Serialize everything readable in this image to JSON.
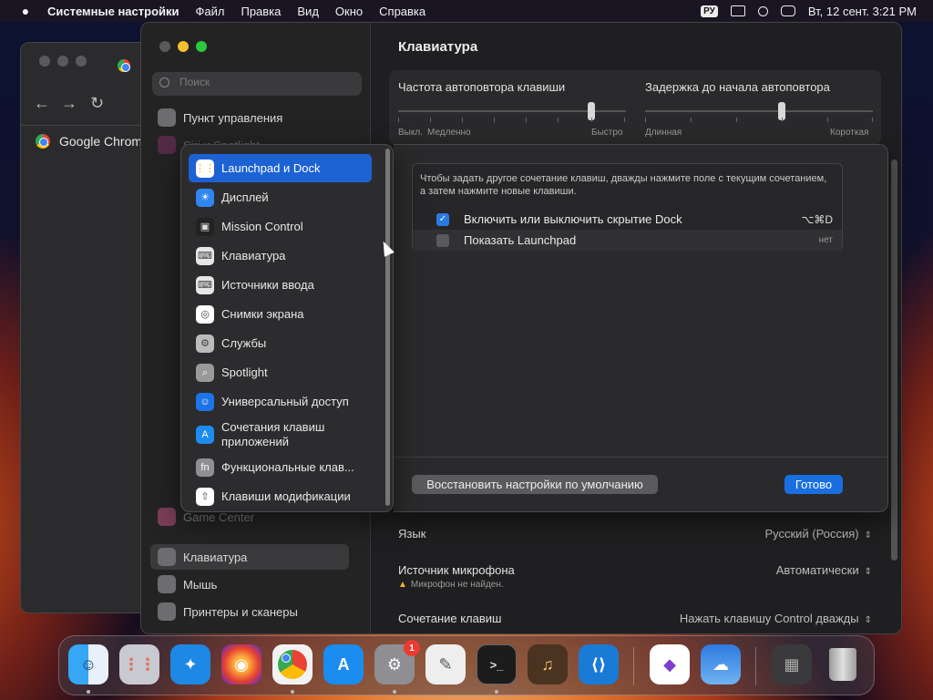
{
  "menubar": {
    "app_name": "Системные настройки",
    "items": [
      "Файл",
      "Правка",
      "Вид",
      "Окно",
      "Справка"
    ],
    "input_language": "РУ",
    "datetime": "Вт, 12 сент.  3:21 PM"
  },
  "chrome_window": {
    "tab_label": "Google Chrome"
  },
  "sidebar": {
    "search_placeholder": "Поиск",
    "items": [
      {
        "label": "Пункт управления",
        "icon": "control-center-icon"
      },
      {
        "label": "Siri и Spotlight",
        "icon": "siri-icon"
      },
      {
        "label": "Game Center",
        "icon": "game-center-icon"
      },
      {
        "label": "Клавиатура",
        "icon": "keyboard-icon"
      },
      {
        "label": "Мышь",
        "icon": "mouse-icon"
      },
      {
        "label": "Принтеры и сканеры",
        "icon": "printer-icon"
      }
    ]
  },
  "main": {
    "title": "Клавиатура",
    "key_repeat": {
      "label": "Частота автоповтора клавиши",
      "min_label": "Выкл.",
      "low_label": "Медленно",
      "max_label": "Быстро"
    },
    "delay_until_repeat": {
      "label": "Задержка до начала автоповтора",
      "min_label": "Длинная",
      "max_label": "Короткая"
    },
    "dictation": {
      "language_label": "Язык",
      "language_value": "Русский (Россия)",
      "mic_label": "Источник микрофона",
      "mic_value": "Автоматически",
      "mic_warning": "Микрофон не найден.",
      "shortcut_label": "Сочетание клавиш",
      "shortcut_value": "Нажать клавишу Control дважды"
    }
  },
  "shortcut_categories": {
    "items": [
      {
        "label": "Launchpad и Dock",
        "icon": "launchpad-icon",
        "glyph": "⋮⋮",
        "selected": true
      },
      {
        "label": "Дисплей",
        "icon": "display-icon",
        "glyph": "☀"
      },
      {
        "label": "Mission Control",
        "icon": "mission-control-icon",
        "glyph": "▣"
      },
      {
        "label": "Клавиатура",
        "icon": "keyboard-icon",
        "glyph": "⌨"
      },
      {
        "label": "Источники ввода",
        "icon": "input-sources-icon",
        "glyph": "⌨"
      },
      {
        "label": "Снимки экрана",
        "icon": "screenshot-icon",
        "glyph": "◎"
      },
      {
        "label": "Службы",
        "icon": "services-icon",
        "glyph": "⚙"
      },
      {
        "label": "Spotlight",
        "icon": "spotlight-icon",
        "glyph": "⌕"
      },
      {
        "label": "Универсальный доступ",
        "icon": "accessibility-icon",
        "glyph": "☺"
      },
      {
        "label": "Сочетания клавиш приложений",
        "icon": "app-shortcuts-icon",
        "glyph": "A"
      },
      {
        "label": "Функциональные клав...",
        "icon": "fn-keys-icon",
        "glyph": "fn"
      },
      {
        "label": "Клавиши модификации",
        "icon": "modifier-keys-icon",
        "glyph": "⇧"
      }
    ]
  },
  "shortcut_panel": {
    "description": "Чтобы задать другое сочетание клавиш, дважды нажмите поле с текущим сочетанием, а затем нажмите новые клавиши.",
    "rows": [
      {
        "label": "Включить или выключить скрытие Dock",
        "keys": "⌥⌘D",
        "checked": true
      },
      {
        "label": "Показать Launchpad",
        "keys": "нет",
        "checked": false
      }
    ],
    "restore_button": "Восстановить настройки по умолчанию",
    "done_button": "Готово"
  },
  "dock": {
    "apps": [
      {
        "name": "finder-icon",
        "color": "#2f8df0",
        "glyph": "☺"
      },
      {
        "name": "launchpad-icon",
        "color": "#c9c9d2",
        "glyph": "⋮⋮"
      },
      {
        "name": "safari-icon",
        "color": "#1e88e5",
        "glyph": "✦"
      },
      {
        "name": "firefox-icon",
        "color": "#6a2fb8",
        "glyph": "◉"
      },
      {
        "name": "chrome-icon",
        "color": "#f2f2f2",
        "glyph": "◉"
      },
      {
        "name": "app-store-icon",
        "color": "#1b8cf0",
        "glyph": "A"
      },
      {
        "name": "system-settings-icon",
        "color": "#8e8e93",
        "glyph": "⚙",
        "badge": "1"
      },
      {
        "name": "textedit-icon",
        "color": "#eeeeee",
        "glyph": "✎"
      },
      {
        "name": "terminal-icon",
        "color": "#1c1c1c",
        "glyph": ">_"
      },
      {
        "name": "garageband-icon",
        "color": "#4a3320",
        "glyph": "♫"
      },
      {
        "name": "vscode-icon",
        "color": "#1a7bd6",
        "glyph": "⟨⟩"
      },
      {
        "name": "visual-studio-icon",
        "color": "#ffffff",
        "glyph": "◆"
      },
      {
        "name": "weather-icon",
        "color": "#3d8de0",
        "glyph": "☁"
      },
      {
        "name": "downloads-stack-icon",
        "color": "#3a3a3c",
        "glyph": "▦"
      },
      {
        "name": "trash-icon",
        "color": "#bdbdbd",
        "glyph": "🗑"
      }
    ]
  }
}
